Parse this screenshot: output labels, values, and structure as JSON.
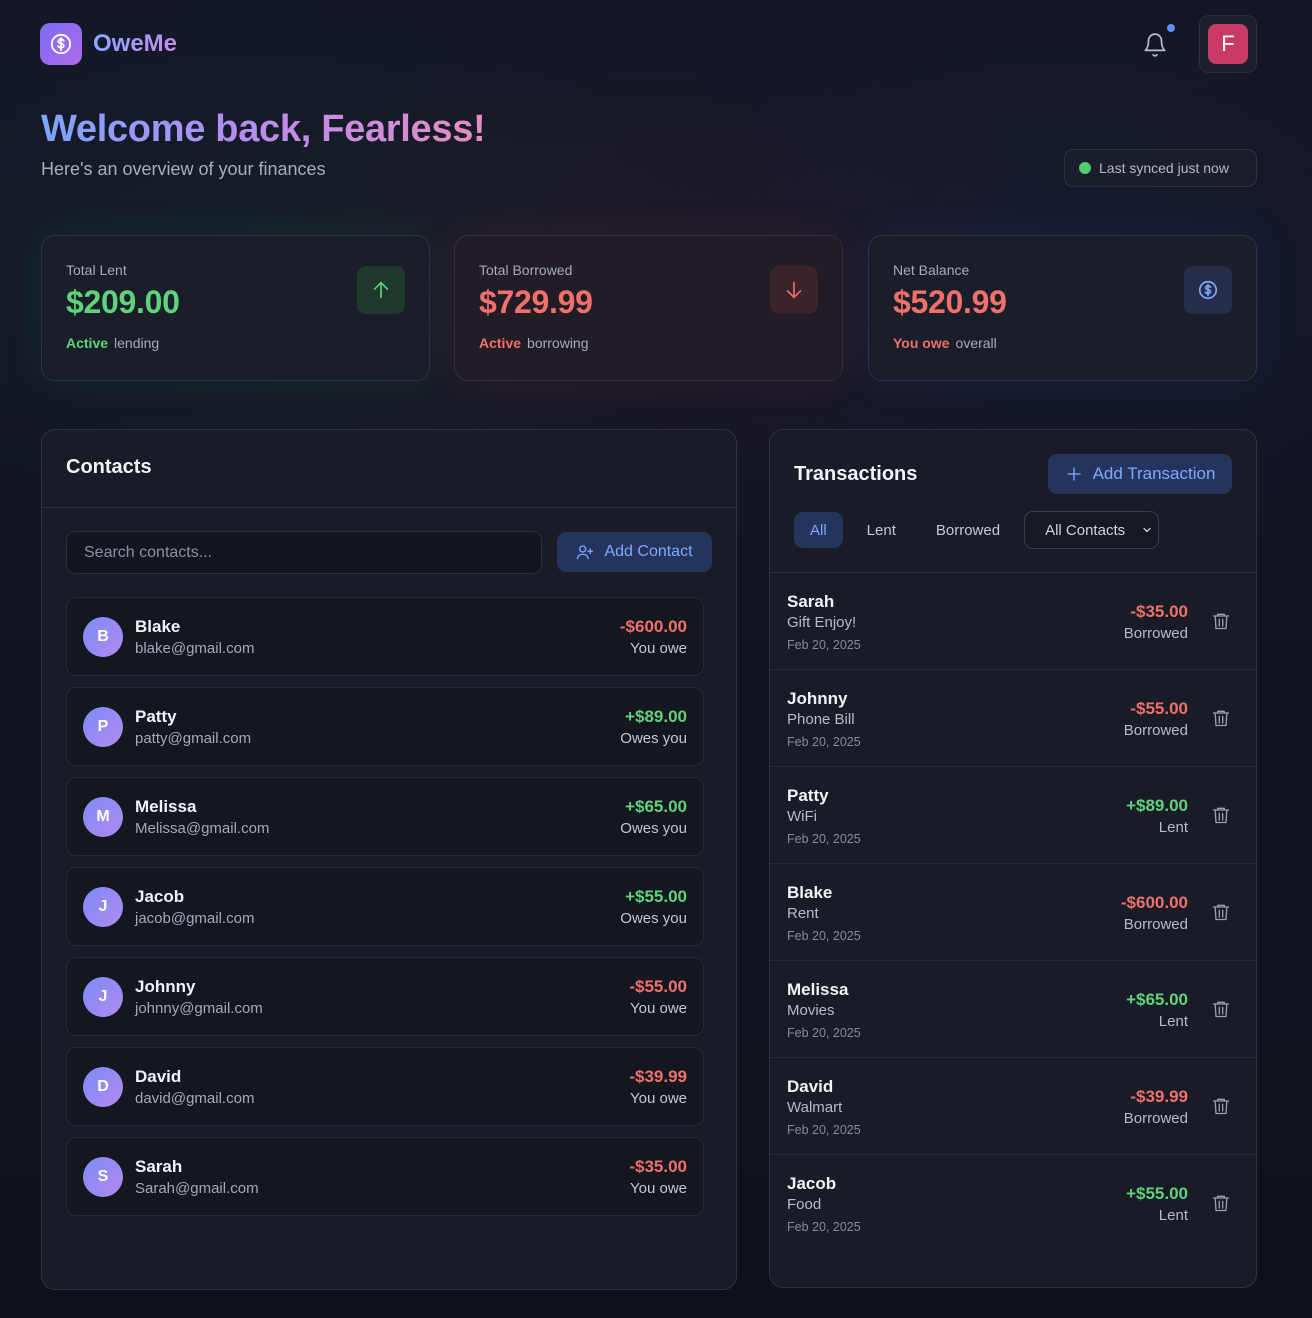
{
  "app": {
    "name": "OweMe",
    "avatar_initial": "F"
  },
  "welcome": {
    "title": "Welcome back, Fearless!",
    "subtitle": "Here's an overview of your finances"
  },
  "sync": {
    "label": "Last synced just now"
  },
  "stats": {
    "lent": {
      "label": "Total Lent",
      "value": "$209.00",
      "status": "Active",
      "suffix": "lending"
    },
    "borrowed": {
      "label": "Total Borrowed",
      "value": "$729.99",
      "status": "Active",
      "suffix": "borrowing"
    },
    "net": {
      "label": "Net Balance",
      "value": "$520.99",
      "status": "You owe",
      "suffix": "overall"
    }
  },
  "contacts": {
    "title": "Contacts",
    "search_placeholder": "Search contacts...",
    "add_label": "Add Contact",
    "items": [
      {
        "initial": "B",
        "name": "Blake",
        "email": "blake@gmail.com",
        "amount": "-$600.00",
        "status": "You owe",
        "tone": "red"
      },
      {
        "initial": "P",
        "name": "Patty",
        "email": "patty@gmail.com",
        "amount": "+$89.00",
        "status": "Owes you",
        "tone": "green"
      },
      {
        "initial": "M",
        "name": "Melissa",
        "email": "Melissa@gmail.com",
        "amount": "+$65.00",
        "status": "Owes you",
        "tone": "green"
      },
      {
        "initial": "J",
        "name": "Jacob",
        "email": "jacob@gmail.com",
        "amount": "+$55.00",
        "status": "Owes you",
        "tone": "green"
      },
      {
        "initial": "J",
        "name": "Johnny",
        "email": "johnny@gmail.com",
        "amount": "-$55.00",
        "status": "You owe",
        "tone": "red"
      },
      {
        "initial": "D",
        "name": "David",
        "email": "david@gmail.com",
        "amount": "-$39.99",
        "status": "You owe",
        "tone": "red"
      },
      {
        "initial": "S",
        "name": "Sarah",
        "email": "Sarah@gmail.com",
        "amount": "-$35.00",
        "status": "You owe",
        "tone": "red"
      }
    ]
  },
  "transactions": {
    "title": "Transactions",
    "add_label": "Add Transaction",
    "filters": [
      "All",
      "Lent",
      "Borrowed"
    ],
    "active_filter": "All",
    "contact_filter": "All Contacts",
    "items": [
      {
        "name": "Sarah",
        "desc": "Gift Enjoy!",
        "date": "Feb 20, 2025",
        "amount": "-$35.00",
        "type": "Borrowed",
        "tone": "red"
      },
      {
        "name": "Johnny",
        "desc": "Phone Bill",
        "date": "Feb 20, 2025",
        "amount": "-$55.00",
        "type": "Borrowed",
        "tone": "red"
      },
      {
        "name": "Patty",
        "desc": "WiFi",
        "date": "Feb 20, 2025",
        "amount": "+$89.00",
        "type": "Lent",
        "tone": "green"
      },
      {
        "name": "Blake",
        "desc": "Rent",
        "date": "Feb 20, 2025",
        "amount": "-$600.00",
        "type": "Borrowed",
        "tone": "red"
      },
      {
        "name": "Melissa",
        "desc": "Movies",
        "date": "Feb 20, 2025",
        "amount": "+$65.00",
        "type": "Lent",
        "tone": "green"
      },
      {
        "name": "David",
        "desc": "Walmart",
        "date": "Feb 20, 2025",
        "amount": "-$39.99",
        "type": "Borrowed",
        "tone": "red"
      },
      {
        "name": "Jacob",
        "desc": "Food",
        "date": "Feb 20, 2025",
        "amount": "+$55.00",
        "type": "Lent",
        "tone": "green"
      }
    ]
  },
  "colors": {
    "positive": "#5fd27b",
    "negative": "#f0706a",
    "accent": "#7fa9ff",
    "avatar": "#c93a66"
  }
}
